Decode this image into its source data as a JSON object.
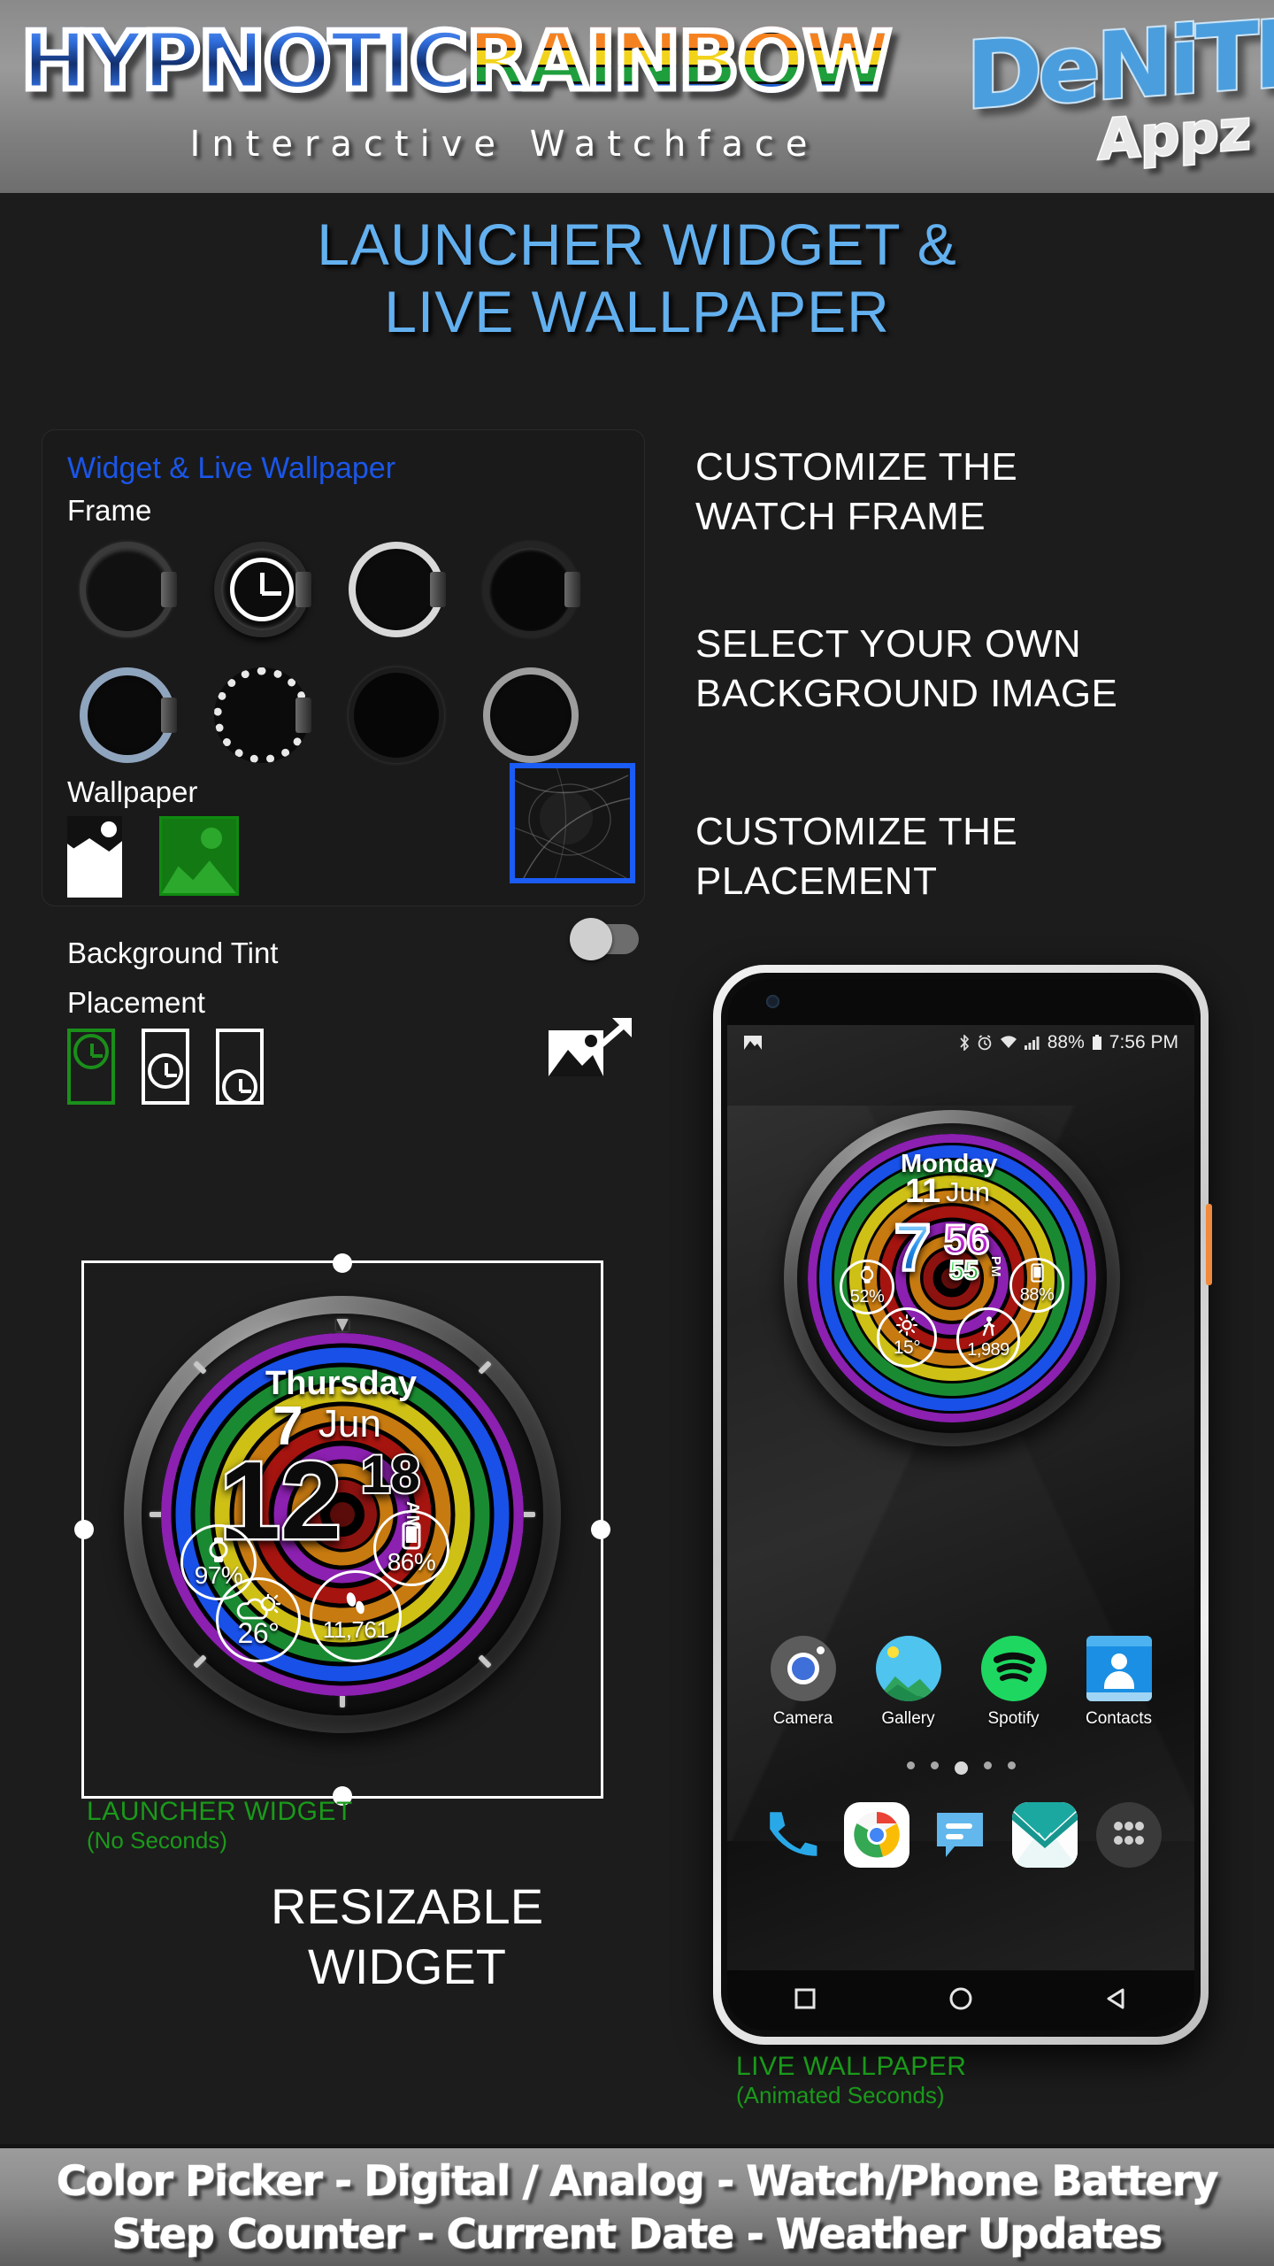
{
  "header": {
    "title_part1": "HYPNOTIC",
    "title_part2": "RAINBOW",
    "subtitle": "Interactive Watchface",
    "brand_main": "DeNiTE!",
    "brand_sub": "Appz"
  },
  "section": {
    "heading_line1": "LAUNCHER WIDGET &",
    "heading_line2": "LIVE WALLPAPER"
  },
  "panel": {
    "title": "Widget & Live Wallpaper",
    "frame_label": "Frame",
    "wallpaper_label": "Wallpaper",
    "background_tint_label": "Background Tint",
    "placement_label": "Placement",
    "tint_toggle_state": "off",
    "frames": [
      {
        "name": "frame-dark-bezel"
      },
      {
        "name": "frame-black-chrono-selected"
      },
      {
        "name": "frame-white-ring"
      },
      {
        "name": "frame-charcoal"
      },
      {
        "name": "frame-blue-steel"
      },
      {
        "name": "frame-silver-knurled"
      },
      {
        "name": "frame-matte-black"
      },
      {
        "name": "frame-brushed-silver"
      }
    ],
    "wallpaper_options": [
      {
        "name": "wallpaper-none-icon"
      },
      {
        "name": "wallpaper-pick-image-icon"
      }
    ],
    "placement_options": [
      {
        "name": "placement-top",
        "selected": true
      },
      {
        "name": "placement-center",
        "selected": false
      },
      {
        "name": "placement-bottom",
        "selected": false
      }
    ]
  },
  "features": {
    "f1_line1": "CUSTOMIZE THE",
    "f1_line2": "WATCH FRAME",
    "f2_line1": "SELECT YOUR OWN",
    "f2_line2": "BACKGROUND IMAGE",
    "f3_line1": "CUSTOMIZE THE",
    "f3_line2": "PLACEMENT"
  },
  "launcher_widget": {
    "day": "Thursday",
    "date_num": "7",
    "month": "Jun",
    "hour": "12",
    "minute": "18",
    "ampm": "AM",
    "watch_battery": "97%",
    "phone_battery": "86%",
    "temperature": "26",
    "degree": "°",
    "steps": "11,761",
    "caption_line1": "LAUNCHER WIDGET",
    "caption_line2": "(No Seconds)",
    "resizable_line1": "RESIZABLE",
    "resizable_line2": "WIDGET"
  },
  "phone": {
    "statusbar": {
      "image_icon": "image-icon",
      "bluetooth_icon": "bluetooth-icon",
      "alarm_icon": "alarm-icon",
      "wifi_icon": "wifi-icon",
      "signal_icon": "signal-icon",
      "battery_percent": "88%",
      "battery_icon": "battery-icon",
      "time": "7:56 PM"
    },
    "watchface": {
      "day": "Monday",
      "date_num": "11",
      "month": "Jun",
      "hour": "7",
      "minute": "56",
      "second": "55",
      "ampm": "PM",
      "watch_battery": "52%",
      "phone_battery": "88%",
      "temperature": "15°",
      "steps": "1,989"
    },
    "apps": [
      {
        "label": "Camera",
        "icon": "camera-icon"
      },
      {
        "label": "Gallery",
        "icon": "gallery-icon"
      },
      {
        "label": "Spotify",
        "icon": "spotify-icon"
      },
      {
        "label": "Contacts",
        "icon": "contacts-icon"
      }
    ],
    "dock": [
      {
        "icon": "phone-icon"
      },
      {
        "icon": "chrome-icon"
      },
      {
        "icon": "messages-icon"
      },
      {
        "icon": "email-icon"
      },
      {
        "icon": "app-drawer-icon"
      }
    ],
    "page_dots": 5,
    "active_dot": 3,
    "caption_line1": "LIVE WALLPAPER",
    "caption_line2": "(Animated Seconds)"
  },
  "footer": {
    "line1": "Color Picker - Digital / Analog - Watch/Phone Battery",
    "line2": "Step Counter - Current Date - Weather Updates"
  }
}
